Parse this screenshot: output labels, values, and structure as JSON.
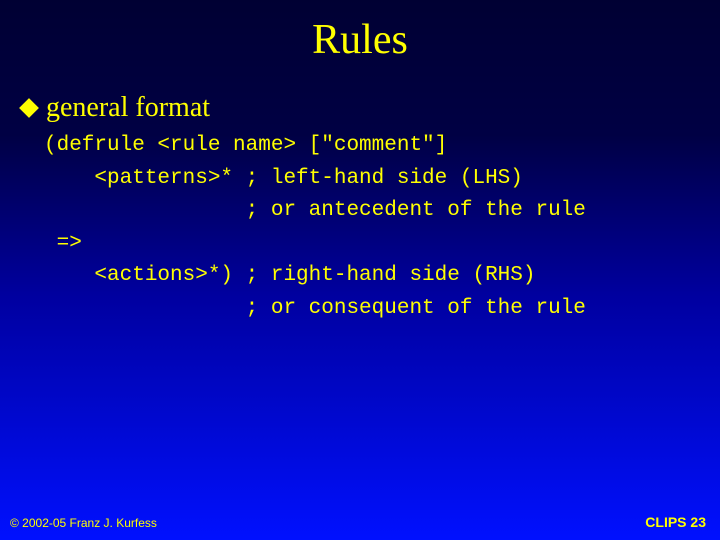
{
  "slide": {
    "title": "Rules",
    "bullet": "general format",
    "code": "(defrule <rule name> [\"comment\"]\n    <patterns>* ; left-hand side (LHS)\n                ; or antecedent of the rule\n =>\n    <actions>*) ; right-hand side (RHS)\n                ; or consequent of the rule",
    "footer_left": "© 2002-05 Franz J. Kurfess",
    "footer_right_label": "CLIPS",
    "footer_right_page": "23"
  }
}
